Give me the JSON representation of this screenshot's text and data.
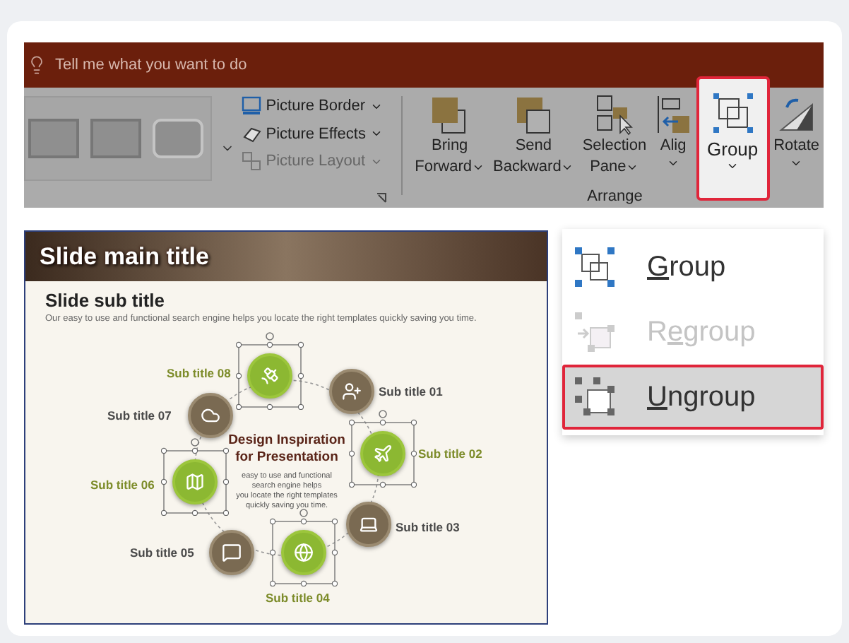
{
  "search": {
    "placeholder": "Tell me what you want to do"
  },
  "ribbon": {
    "picture_tools": [
      {
        "kind": "border",
        "label": "Picture Border",
        "disabled": false
      },
      {
        "kind": "effects",
        "label": "Picture Effects",
        "disabled": false
      },
      {
        "kind": "layout",
        "label": "Picture Layout",
        "disabled": true
      }
    ],
    "arrange_buttons": [
      {
        "kind": "bring",
        "line1": "Bring",
        "line2": "Forward",
        "selected": false
      },
      {
        "kind": "send",
        "line1": "Send",
        "line2": "Backward",
        "selected": false
      },
      {
        "kind": "pane",
        "line1": "Selection",
        "line2": "Pane",
        "selected": false
      },
      {
        "kind": "align",
        "line1": "Alig",
        "selected": false
      },
      {
        "kind": "group",
        "line1": "Group",
        "selected": true
      },
      {
        "kind": "rotate",
        "line1": "Rotate",
        "selected": false
      }
    ],
    "group_label": "Arrange"
  },
  "menu": {
    "items": [
      {
        "kind": "group",
        "key": "G",
        "post": "roup",
        "disabled": false,
        "selected": false
      },
      {
        "kind": "regroup",
        "pre": "R",
        "key": "e",
        "post": "group",
        "disabled": true,
        "selected": false
      },
      {
        "kind": "ungroup",
        "key": "U",
        "post": "ngroup",
        "disabled": false,
        "selected": true
      }
    ]
  },
  "slide": {
    "title": "Slide main title",
    "subtitle": "Slide sub title",
    "description": "Our easy to use and functional search engine helps you locate the right templates quickly  saving you time.",
    "center_title": [
      "Design Inspiration",
      "for Presentation"
    ],
    "center_text": [
      "easy to use and functional",
      "search engine helps",
      "you locate the right templates",
      "quickly saving you time."
    ],
    "nodes": [
      {
        "kind": "satellite",
        "label": "Sub title 08",
        "selected": true
      },
      {
        "kind": "user",
        "label": "Sub title 01",
        "selected": false
      },
      {
        "kind": "plane",
        "label": "Sub title 02",
        "selected": true
      },
      {
        "kind": "laptop",
        "label": "Sub title 03",
        "selected": false
      },
      {
        "kind": "globe",
        "label": "Sub title 04",
        "selected": true
      },
      {
        "kind": "chat",
        "label": "Sub title 05",
        "selected": false
      },
      {
        "kind": "map",
        "label": "Sub title 06",
        "selected": true
      },
      {
        "kind": "cloud",
        "label": "Sub title 07",
        "selected": false
      }
    ]
  }
}
